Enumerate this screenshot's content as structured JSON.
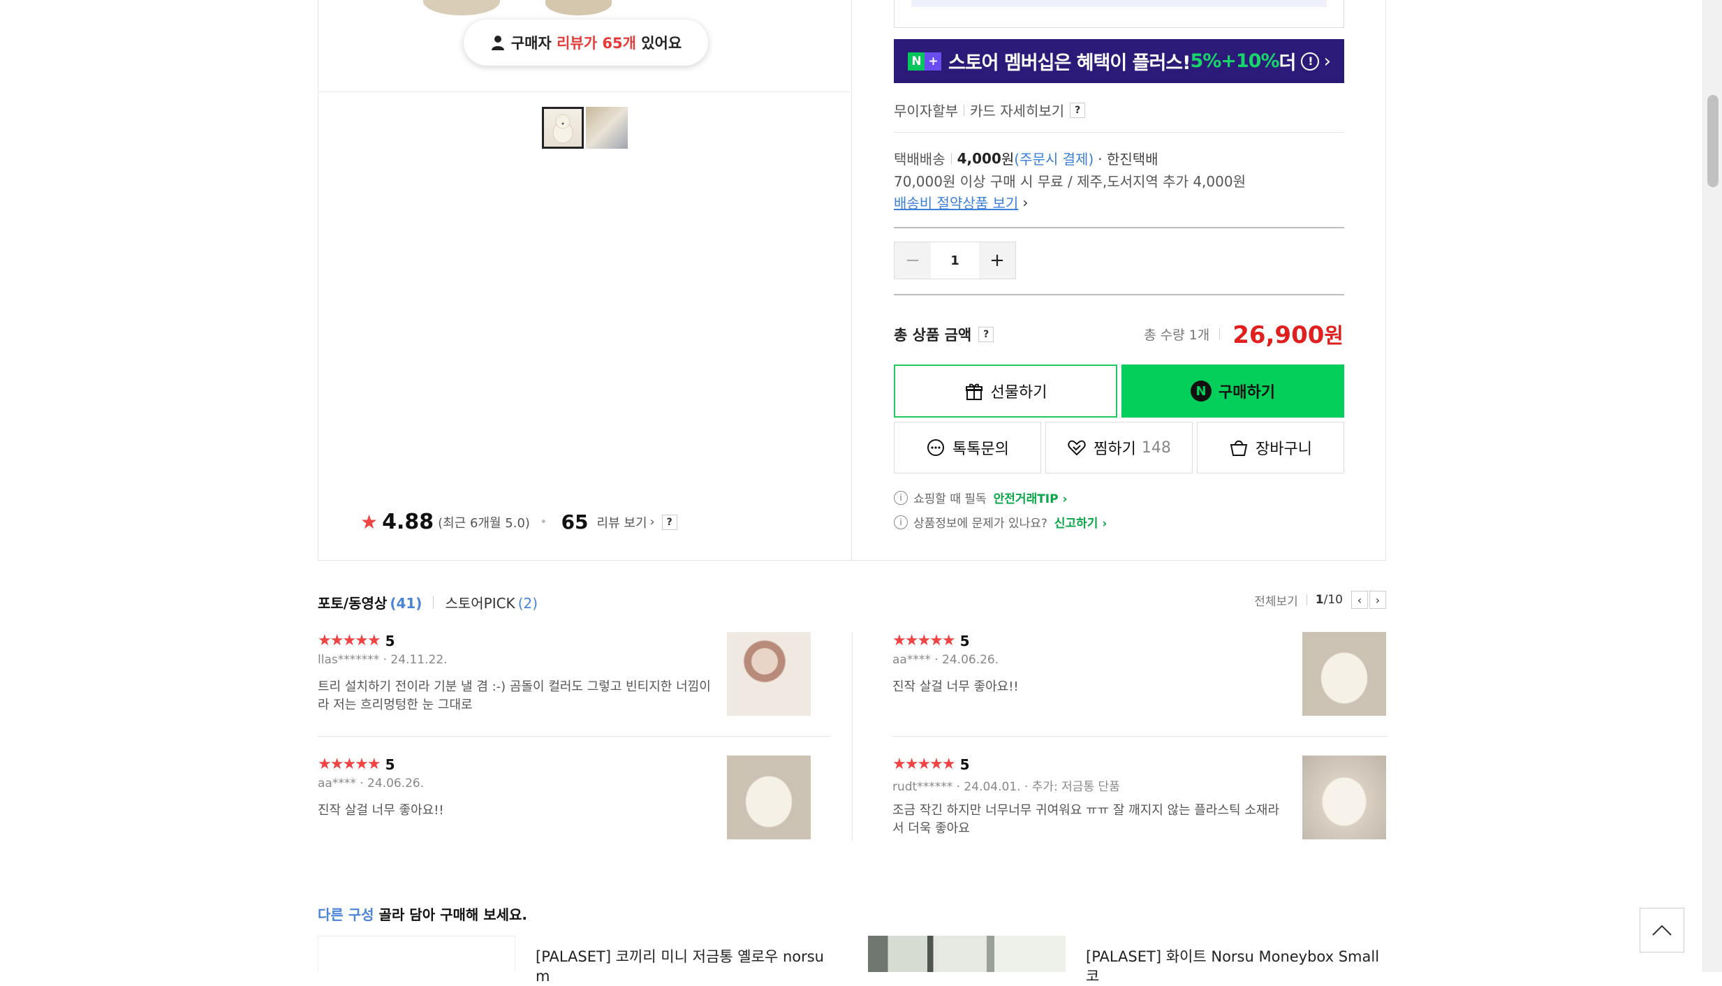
{
  "product_gallery": {
    "review_pill": {
      "prefix": "구매자",
      "highlight_word": "리뷰가",
      "highlight_count": "65개",
      "suffix": "있어요"
    },
    "rating": {
      "score": "4.88",
      "recent": "(최근 6개월 5.0)",
      "review_count": "65",
      "review_link": "리뷰 보기",
      "help": "?"
    }
  },
  "purchase": {
    "membership_banner": {
      "badge_n": "N",
      "badge_plus": "+",
      "text": "스토어 멤버십은 혜택이 플러스!",
      "highlight": "5%+10%",
      "suffix": "더",
      "info": "!",
      "chevron": "›"
    },
    "installment": {
      "free": "무이자할부",
      "card": "카드 자세히보기",
      "help": "?"
    },
    "shipping": {
      "label": "택배배송",
      "price": "4,000",
      "won": "원",
      "payment_note": "(주문시 결제)",
      "courier": "· 한진택배",
      "condition": "70,000원 이상 구매 시 무료 / 제주,도서지역 추가 4,000원",
      "saving_link": "배송비 절약상품 보기",
      "saving_chevron": "›"
    },
    "quantity": {
      "minus": "−",
      "value": "1",
      "plus": "+"
    },
    "total": {
      "label": "총 상품 금액",
      "help": "?",
      "qty_text": "총 수량 1개",
      "price": "26,900",
      "won": "원"
    },
    "buttons": {
      "gift": "선물하기",
      "buy_icon": "N",
      "buy": "구매하기",
      "talk": "톡톡문의",
      "wish": "찜하기",
      "wish_count": "148",
      "cart": "장바구니"
    },
    "tips": {
      "info_glyph": "i",
      "safe_text": "쇼핑할 때 필독",
      "safe_link": "안전거래TIP ›",
      "report_text": "상품정보에 문제가 있나요?",
      "report_link": "신고하기 ›"
    }
  },
  "reviews": {
    "tabs": [
      {
        "label": "포토/동영상",
        "count": "(41)"
      },
      {
        "label": "스토어PICK",
        "count": "(2)"
      }
    ],
    "view_all": "전체보기",
    "page_current": "1",
    "page_total": "/10",
    "prev": "‹",
    "next": "›",
    "items": [
      {
        "stars": "★★★★★",
        "score": "5",
        "meta": "llas******* · 24.11.22.",
        "body": "트리 설치하기 전이라 기분 낼 겸 :-) 곰돌이 컬러도 그렇고 빈티지한 너낌이라 저는 흐리멍텅한 눈 그대로"
      },
      {
        "stars": "★★★★★",
        "score": "5",
        "meta": "aa**** · 24.06.26.",
        "body": "진작 살걸 너무 좋아요!!"
      },
      {
        "stars": "★★★★★",
        "score": "5",
        "meta": "aa**** · 24.06.26.",
        "body": "진작 살걸 너무 좋아요!!"
      },
      {
        "stars": "★★★★★",
        "score": "5",
        "meta": "rudt****** · 24.04.01. · 추가: 저금통 단품",
        "body": "조금 작긴 하지만 너무너무 귀여워요 ㅠㅠ 잘 깨지지 않는 플라스틱 소재라서 더욱 좋아요"
      }
    ]
  },
  "other_options": {
    "title_highlight": "다른 구성",
    "title_rest": "골라 담아 구매해 보세요.",
    "cards": [
      {
        "name": "[PALASET] 코끼리 미니 저금통 옐로우 norsu m"
      },
      {
        "name": "[PALASET] 화이트 Norsu Moneybox Small 코"
      }
    ]
  },
  "colors": {
    "accent_green": "#04cf5a",
    "price_red": "#e0201e",
    "star_red": "#f04444",
    "membership_bg": "#2b1a78",
    "link_blue": "#4a84d6"
  }
}
